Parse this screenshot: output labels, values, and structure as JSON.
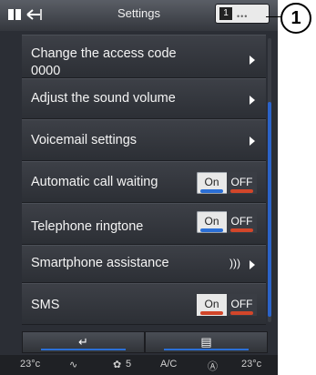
{
  "header": {
    "title": "Settings"
  },
  "rows": [
    {
      "label": "Change the access code",
      "sublabel": "0000"
    },
    {
      "label": "Adjust the sound volume"
    },
    {
      "label": "Voicemail settings"
    },
    {
      "label": "Automatic call waiting",
      "on_label": "On",
      "off_label": "OFF"
    },
    {
      "label": "Telephone ringtone",
      "on_label": "On",
      "off_label": "OFF"
    },
    {
      "label": "Smartphone assistance"
    },
    {
      "label": "SMS",
      "on_label": "On",
      "off_label": "OFF"
    }
  ],
  "climate": {
    "left_temp": "23°c",
    "fan_speed": "5",
    "ac_label": "A/C",
    "right_temp": "23°c"
  },
  "callout": {
    "number": "1"
  },
  "colors": {
    "accent_blue": "#2b6fd6",
    "accent_red": "#d2462a"
  }
}
